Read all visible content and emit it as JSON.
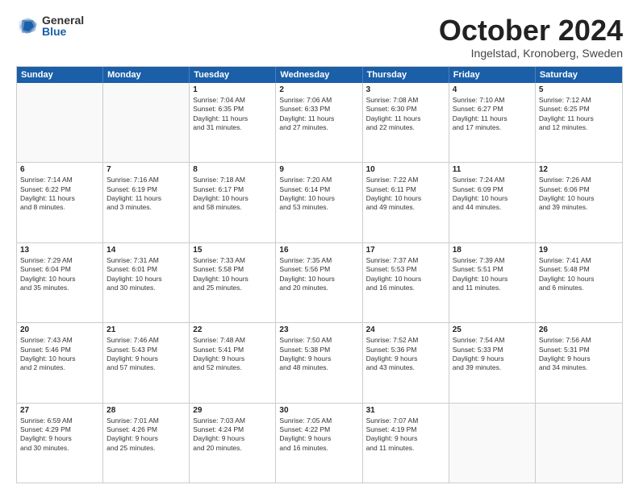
{
  "logo": {
    "general": "General",
    "blue": "Blue"
  },
  "title": "October 2024",
  "subtitle": "Ingelstad, Kronoberg, Sweden",
  "header_days": [
    "Sunday",
    "Monday",
    "Tuesday",
    "Wednesday",
    "Thursday",
    "Friday",
    "Saturday"
  ],
  "rows": [
    [
      {
        "day": "",
        "lines": [],
        "empty": true
      },
      {
        "day": "",
        "lines": [],
        "empty": true
      },
      {
        "day": "1",
        "lines": [
          "Sunrise: 7:04 AM",
          "Sunset: 6:35 PM",
          "Daylight: 11 hours",
          "and 31 minutes."
        ]
      },
      {
        "day": "2",
        "lines": [
          "Sunrise: 7:06 AM",
          "Sunset: 6:33 PM",
          "Daylight: 11 hours",
          "and 27 minutes."
        ]
      },
      {
        "day": "3",
        "lines": [
          "Sunrise: 7:08 AM",
          "Sunset: 6:30 PM",
          "Daylight: 11 hours",
          "and 22 minutes."
        ]
      },
      {
        "day": "4",
        "lines": [
          "Sunrise: 7:10 AM",
          "Sunset: 6:27 PM",
          "Daylight: 11 hours",
          "and 17 minutes."
        ]
      },
      {
        "day": "5",
        "lines": [
          "Sunrise: 7:12 AM",
          "Sunset: 6:25 PM",
          "Daylight: 11 hours",
          "and 12 minutes."
        ]
      }
    ],
    [
      {
        "day": "6",
        "lines": [
          "Sunrise: 7:14 AM",
          "Sunset: 6:22 PM",
          "Daylight: 11 hours",
          "and 8 minutes."
        ]
      },
      {
        "day": "7",
        "lines": [
          "Sunrise: 7:16 AM",
          "Sunset: 6:19 PM",
          "Daylight: 11 hours",
          "and 3 minutes."
        ]
      },
      {
        "day": "8",
        "lines": [
          "Sunrise: 7:18 AM",
          "Sunset: 6:17 PM",
          "Daylight: 10 hours",
          "and 58 minutes."
        ]
      },
      {
        "day": "9",
        "lines": [
          "Sunrise: 7:20 AM",
          "Sunset: 6:14 PM",
          "Daylight: 10 hours",
          "and 53 minutes."
        ]
      },
      {
        "day": "10",
        "lines": [
          "Sunrise: 7:22 AM",
          "Sunset: 6:11 PM",
          "Daylight: 10 hours",
          "and 49 minutes."
        ]
      },
      {
        "day": "11",
        "lines": [
          "Sunrise: 7:24 AM",
          "Sunset: 6:09 PM",
          "Daylight: 10 hours",
          "and 44 minutes."
        ]
      },
      {
        "day": "12",
        "lines": [
          "Sunrise: 7:26 AM",
          "Sunset: 6:06 PM",
          "Daylight: 10 hours",
          "and 39 minutes."
        ]
      }
    ],
    [
      {
        "day": "13",
        "lines": [
          "Sunrise: 7:29 AM",
          "Sunset: 6:04 PM",
          "Daylight: 10 hours",
          "and 35 minutes."
        ]
      },
      {
        "day": "14",
        "lines": [
          "Sunrise: 7:31 AM",
          "Sunset: 6:01 PM",
          "Daylight: 10 hours",
          "and 30 minutes."
        ]
      },
      {
        "day": "15",
        "lines": [
          "Sunrise: 7:33 AM",
          "Sunset: 5:58 PM",
          "Daylight: 10 hours",
          "and 25 minutes."
        ]
      },
      {
        "day": "16",
        "lines": [
          "Sunrise: 7:35 AM",
          "Sunset: 5:56 PM",
          "Daylight: 10 hours",
          "and 20 minutes."
        ]
      },
      {
        "day": "17",
        "lines": [
          "Sunrise: 7:37 AM",
          "Sunset: 5:53 PM",
          "Daylight: 10 hours",
          "and 16 minutes."
        ]
      },
      {
        "day": "18",
        "lines": [
          "Sunrise: 7:39 AM",
          "Sunset: 5:51 PM",
          "Daylight: 10 hours",
          "and 11 minutes."
        ]
      },
      {
        "day": "19",
        "lines": [
          "Sunrise: 7:41 AM",
          "Sunset: 5:48 PM",
          "Daylight: 10 hours",
          "and 6 minutes."
        ]
      }
    ],
    [
      {
        "day": "20",
        "lines": [
          "Sunrise: 7:43 AM",
          "Sunset: 5:46 PM",
          "Daylight: 10 hours",
          "and 2 minutes."
        ]
      },
      {
        "day": "21",
        "lines": [
          "Sunrise: 7:46 AM",
          "Sunset: 5:43 PM",
          "Daylight: 9 hours",
          "and 57 minutes."
        ]
      },
      {
        "day": "22",
        "lines": [
          "Sunrise: 7:48 AM",
          "Sunset: 5:41 PM",
          "Daylight: 9 hours",
          "and 52 minutes."
        ]
      },
      {
        "day": "23",
        "lines": [
          "Sunrise: 7:50 AM",
          "Sunset: 5:38 PM",
          "Daylight: 9 hours",
          "and 48 minutes."
        ]
      },
      {
        "day": "24",
        "lines": [
          "Sunrise: 7:52 AM",
          "Sunset: 5:36 PM",
          "Daylight: 9 hours",
          "and 43 minutes."
        ]
      },
      {
        "day": "25",
        "lines": [
          "Sunrise: 7:54 AM",
          "Sunset: 5:33 PM",
          "Daylight: 9 hours",
          "and 39 minutes."
        ]
      },
      {
        "day": "26",
        "lines": [
          "Sunrise: 7:56 AM",
          "Sunset: 5:31 PM",
          "Daylight: 9 hours",
          "and 34 minutes."
        ]
      }
    ],
    [
      {
        "day": "27",
        "lines": [
          "Sunrise: 6:59 AM",
          "Sunset: 4:29 PM",
          "Daylight: 9 hours",
          "and 30 minutes."
        ]
      },
      {
        "day": "28",
        "lines": [
          "Sunrise: 7:01 AM",
          "Sunset: 4:26 PM",
          "Daylight: 9 hours",
          "and 25 minutes."
        ]
      },
      {
        "day": "29",
        "lines": [
          "Sunrise: 7:03 AM",
          "Sunset: 4:24 PM",
          "Daylight: 9 hours",
          "and 20 minutes."
        ]
      },
      {
        "day": "30",
        "lines": [
          "Sunrise: 7:05 AM",
          "Sunset: 4:22 PM",
          "Daylight: 9 hours",
          "and 16 minutes."
        ]
      },
      {
        "day": "31",
        "lines": [
          "Sunrise: 7:07 AM",
          "Sunset: 4:19 PM",
          "Daylight: 9 hours",
          "and 11 minutes."
        ]
      },
      {
        "day": "",
        "lines": [],
        "empty": true
      },
      {
        "day": "",
        "lines": [],
        "empty": true
      }
    ]
  ]
}
